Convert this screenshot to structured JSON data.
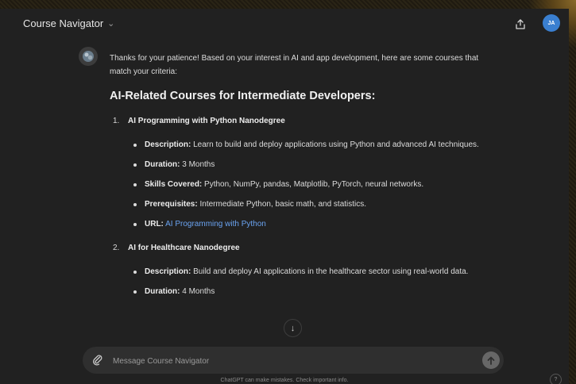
{
  "header": {
    "title": "Course Navigator",
    "avatar_initials": "JA"
  },
  "message": {
    "intro": "Thanks for your patience! Based on your interest in AI and app development, here are some courses that match your criteria:",
    "heading": "AI-Related Courses for Intermediate Developers:",
    "courses": [
      {
        "number": "1.",
        "title": "AI Programming with Python Nanodegree",
        "description_label": "Description:",
        "description": "Learn to build and deploy applications using Python and advanced AI techniques.",
        "duration_label": "Duration:",
        "duration": "3 Months",
        "skills_label": "Skills Covered:",
        "skills": "Python, NumPy, pandas, Matplotlib, PyTorch, neural networks.",
        "prereq_label": "Prerequisites:",
        "prereq": "Intermediate Python, basic math, and statistics.",
        "url_label": "URL:",
        "url_text": "AI Programming with Python"
      },
      {
        "number": "2.",
        "title": "AI for Healthcare Nanodegree",
        "description_label": "Description:",
        "description": "Build and deploy AI applications in the healthcare sector using real-world data.",
        "duration_label": "Duration:",
        "duration": "4 Months"
      }
    ]
  },
  "composer": {
    "placeholder": "Message Course Navigator"
  },
  "footer": {
    "disclaimer": "ChatGPT can make mistakes. Check important info.",
    "help": "?"
  },
  "colors": {
    "background": "#212121",
    "accent_link": "#6aa3f0",
    "avatar": "#3a7fd0"
  }
}
